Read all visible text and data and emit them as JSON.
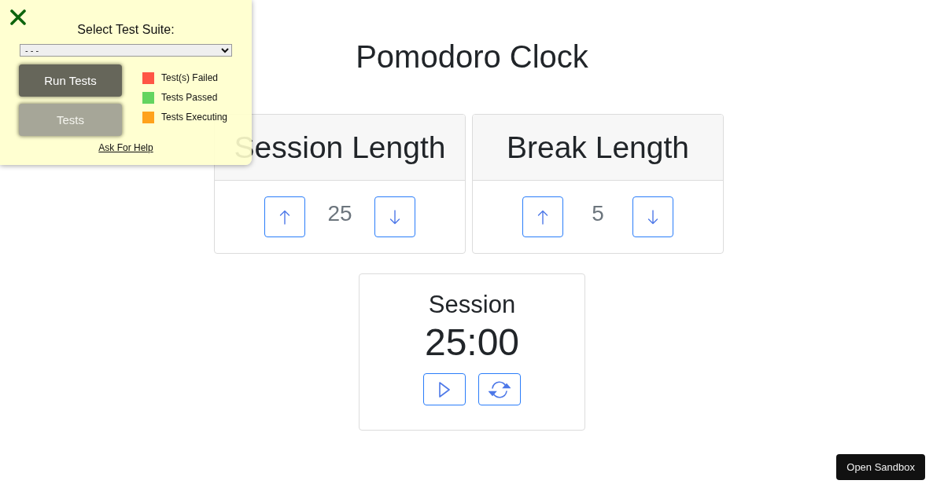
{
  "test_panel": {
    "title": "Select Test Suite:",
    "suite_select": {
      "value": "- - -"
    },
    "buttons": [
      {
        "label": "Run Tests",
        "kind": "primary"
      },
      {
        "label": "Tests",
        "kind": "secondary"
      }
    ],
    "legend": [
      {
        "label": "Test(s) Failed",
        "color": "#ff5545"
      },
      {
        "label": "Tests Passed",
        "color": "#63d45f"
      },
      {
        "label": "Tests Executing",
        "color": "#ffa21c"
      }
    ],
    "help_link": "Ask For Help"
  },
  "app": {
    "title": "Pomodoro Clock",
    "settings": [
      {
        "label": "Session Length",
        "value": "25"
      },
      {
        "label": "Break Length",
        "value": "5"
      }
    ],
    "timer": {
      "label": "Session",
      "time": "25:00"
    }
  },
  "sandbox_button": "Open Sandbox"
}
